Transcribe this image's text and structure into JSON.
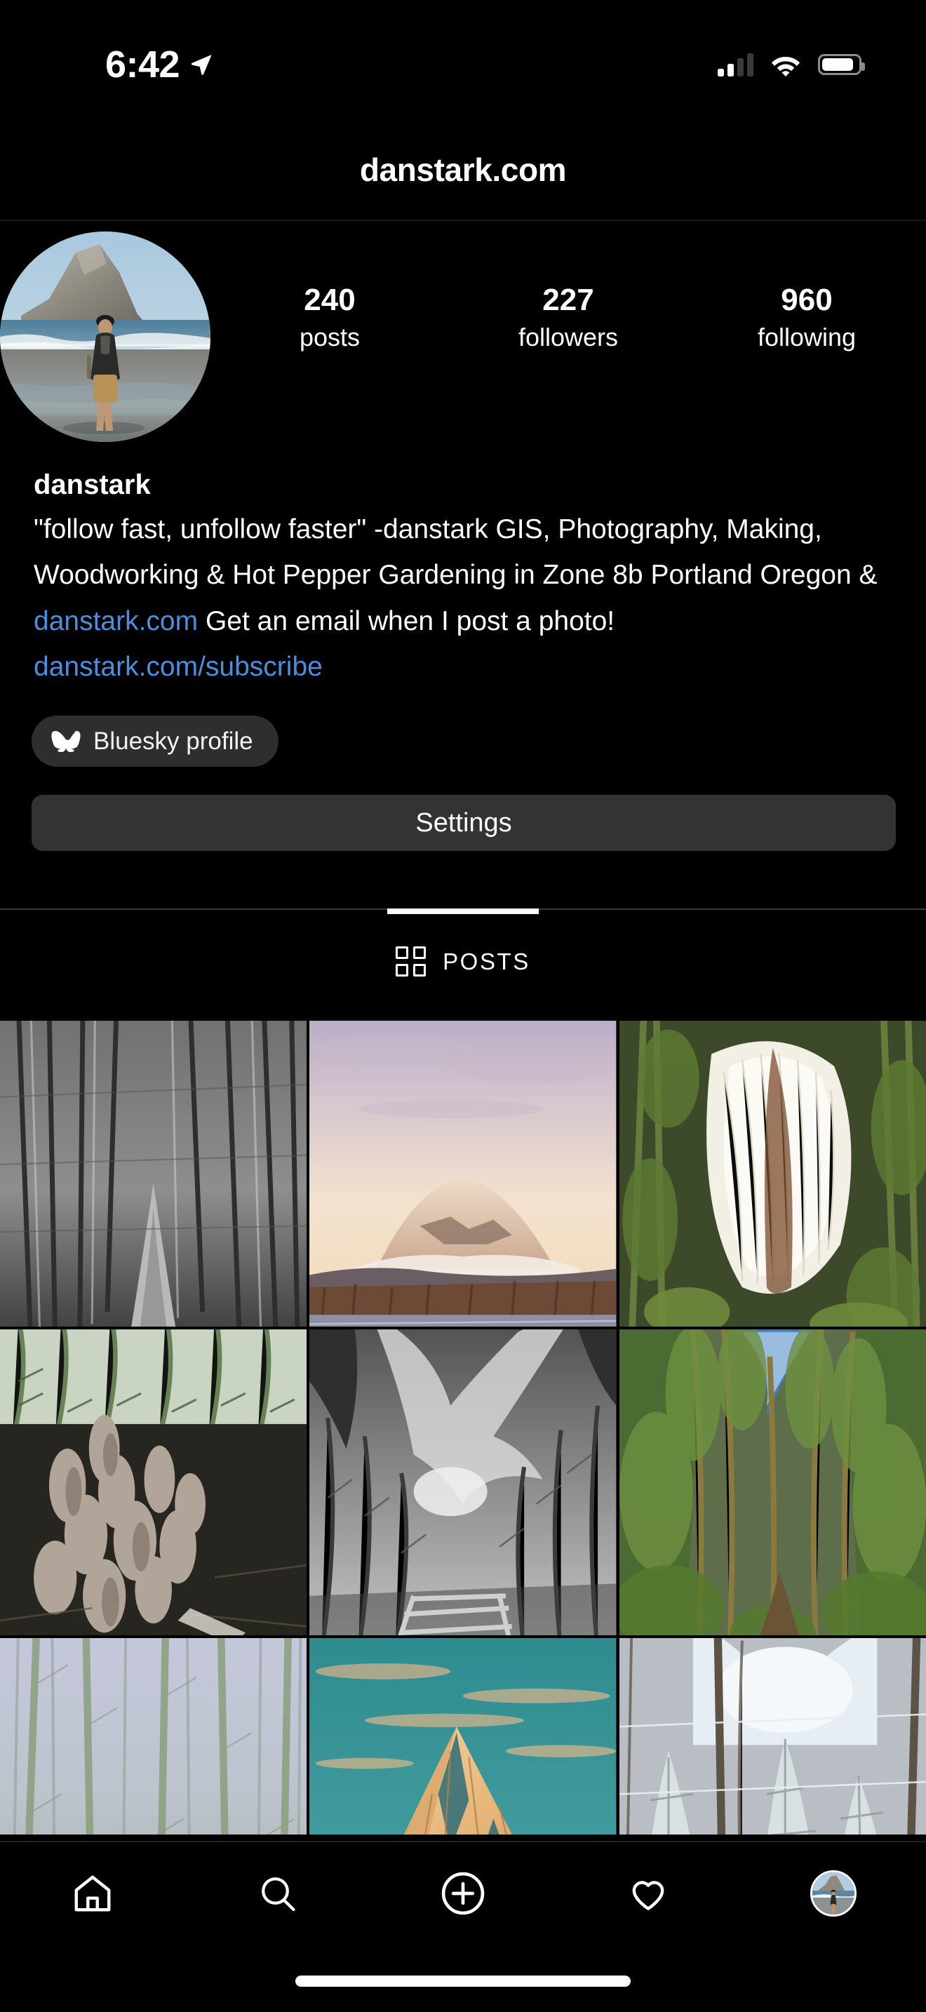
{
  "status_bar": {
    "time": "6:42",
    "location_icon": "location-arrow-icon",
    "signal_icon": "cellular-signal-icon",
    "signal_bars_active": 2,
    "signal_bars_total": 4,
    "wifi_icon": "wifi-icon",
    "battery_icon": "battery-icon",
    "battery_level_pct": 85
  },
  "header": {
    "title": "danstark.com"
  },
  "profile": {
    "avatar_alt": "person walking on beach with sea stack rock",
    "stats": [
      {
        "value": "240",
        "label": "posts"
      },
      {
        "value": "227",
        "label": "followers"
      },
      {
        "value": "960",
        "label": "following"
      }
    ],
    "username": "danstark",
    "bio_segments": [
      {
        "text": "\"follow fast, unfollow faster\" -danstark GIS, Photography, Making, Woodworking & Hot Pepper Gardening in Zone 8b Portland Oregon & ",
        "link": false
      },
      {
        "text": "danstark.com",
        "link": true
      },
      {
        "text": " Get an email when I post a photo! ",
        "link": false
      },
      {
        "text": "danstark.com/subscribe",
        "link": true
      }
    ],
    "link_color": "#4a8ee0",
    "bluesky_chip": {
      "icon": "butterfly-icon",
      "label": "Bluesky profile"
    },
    "settings_button_label": "Settings"
  },
  "tabs": [
    {
      "label": "POSTS",
      "icon": "grid-icon",
      "active": true
    }
  ],
  "photo_grid": [
    {
      "alt": "black and white forest path with bare trees"
    },
    {
      "alt": "Mount St Helens at sunset with pink sky over treeline and lake"
    },
    {
      "alt": "white hair ice formation on mossy log"
    },
    {
      "alt": "cluster of inky cap mushrooms among ferns"
    },
    {
      "alt": "black and white dramatic clouds above winter trees and fence"
    },
    {
      "alt": "tall green forest trail looking up at canopy with blue sky"
    },
    {
      "alt": "misty pale green forest of slender trees"
    },
    {
      "alt": "Mount Hood snowy peak at golden hour with teal sky"
    },
    {
      "alt": "snow covered evergreen forest"
    }
  ],
  "bottom_nav": [
    {
      "icon": "home-icon",
      "name": "home"
    },
    {
      "icon": "search-icon",
      "name": "search"
    },
    {
      "icon": "create-plus-icon",
      "name": "create"
    },
    {
      "icon": "heart-icon",
      "name": "activity"
    },
    {
      "icon": "profile-avatar-icon",
      "name": "profile"
    }
  ]
}
